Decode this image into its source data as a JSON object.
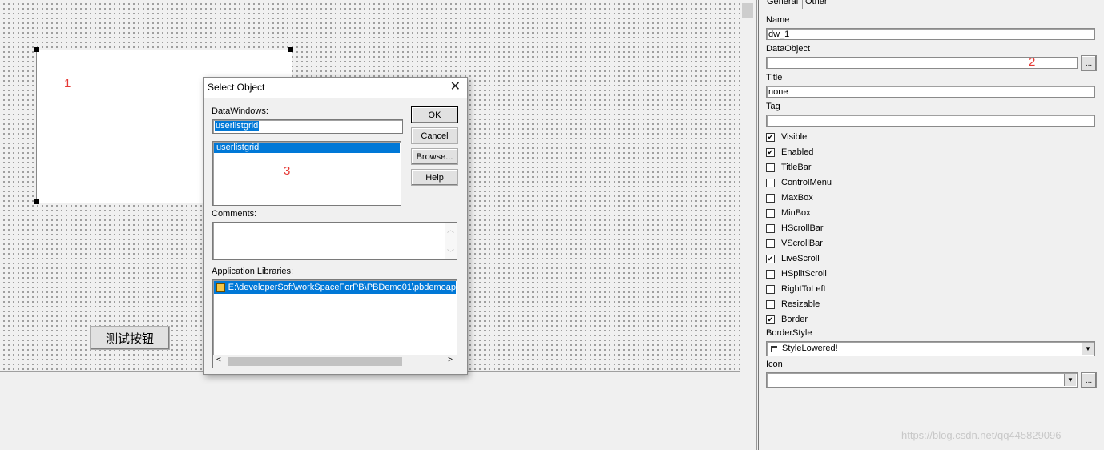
{
  "canvas": {
    "dw_marker": "1",
    "test_button_label": "测试按钮"
  },
  "dialog": {
    "title": "Select Object",
    "close_glyph": "✕",
    "datawindows_label": "DataWindows:",
    "datawindow_name_value": "userlistgrid",
    "datawindow_list": [
      "userlistgrid"
    ],
    "list_marker": "3",
    "comments_label": "Comments:",
    "comments_value": "",
    "app_libraries_label": "Application Libraries:",
    "app_libraries": [
      "E:\\developerSoft\\workSpaceForPB\\PBDemo01\\pbdemoap"
    ],
    "buttons": {
      "ok": "OK",
      "cancel": "Cancel",
      "browse": "Browse...",
      "help": "Help"
    }
  },
  "panel": {
    "tabs": [
      "General",
      "Other"
    ],
    "name_label": "Name",
    "name_value": "dw_1",
    "dataobject_label": "DataObject",
    "dataobject_value": "",
    "dataobject_marker": "2",
    "title_label": "Title",
    "title_value": "none",
    "tag_label": "Tag",
    "tag_value": "",
    "checkboxes": [
      {
        "label": "Visible",
        "checked": true
      },
      {
        "label": "Enabled",
        "checked": true
      },
      {
        "label": "TitleBar",
        "checked": false
      },
      {
        "label": "ControlMenu",
        "checked": false
      },
      {
        "label": "MaxBox",
        "checked": false
      },
      {
        "label": "MinBox",
        "checked": false
      },
      {
        "label": "HScrollBar",
        "checked": false
      },
      {
        "label": "VScrollBar",
        "checked": false
      },
      {
        "label": "LiveScroll",
        "checked": true
      },
      {
        "label": "HSplitScroll",
        "checked": false
      },
      {
        "label": "RightToLeft",
        "checked": false
      },
      {
        "label": "Resizable",
        "checked": false
      },
      {
        "label": "Border",
        "checked": true
      }
    ],
    "borderstyle_label": "BorderStyle",
    "borderstyle_value": "StyleLowered!",
    "icon_label": "Icon",
    "icon_value": "",
    "ellipsis": "..."
  },
  "watermark": "https://blog.csdn.net/qq445829096",
  "colors": {
    "selection": "#0078d7",
    "marker": "#e53935"
  }
}
